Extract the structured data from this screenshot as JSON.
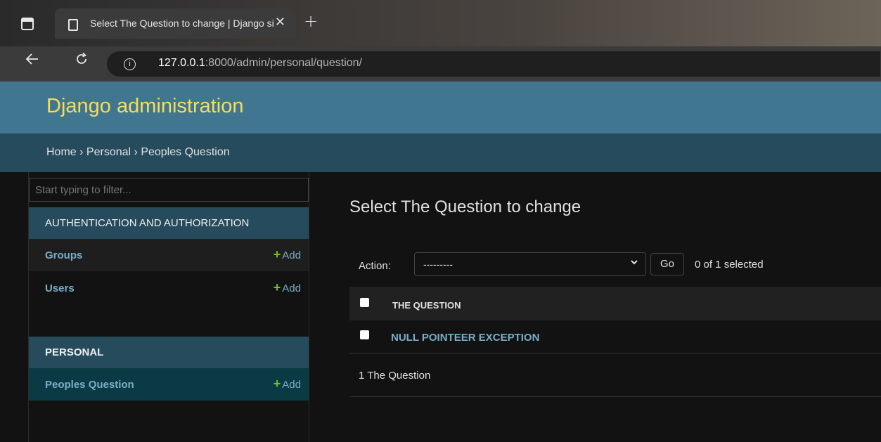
{
  "browser": {
    "tab_title": "Select The Question to change | Django site admin",
    "close_glyph": "✕",
    "new_tab_glyph": "+",
    "url_host": "127.0.0.1",
    "url_path": ":8000/admin/personal/question/"
  },
  "header": {
    "brand": "Django administration"
  },
  "breadcrumbs": {
    "home": "Home",
    "sep": "›",
    "app": "Personal",
    "current": "Peoples Question"
  },
  "sidebar": {
    "filter_placeholder": "Start typing to filter...",
    "modules": [
      {
        "caption": "AUTHENTICATION AND AUTHORIZATION",
        "items": [
          {
            "label": "Groups",
            "add": "Add"
          },
          {
            "label": "Users",
            "add": "Add"
          }
        ]
      },
      {
        "caption": "PERSONAL",
        "items": [
          {
            "label": "Peoples Question",
            "add": "Add"
          }
        ]
      }
    ]
  },
  "main": {
    "title": "Select The Question to change",
    "action_label": "Action:",
    "action_value": "---------",
    "go_label": "Go",
    "selected_text": "0 of 1 selected",
    "column_header": "THE QUESTION",
    "rows": [
      {
        "label": "NULL POINTEER EXCEPTION"
      }
    ],
    "paginator": "1 The Question"
  },
  "colors": {
    "header_bg": "#417690",
    "breadcrumb_bg": "#264b5d",
    "brand": "#f5dd5d",
    "link": "#79aec8",
    "add_plus": "#70bf2b",
    "selected_row_bg": "#0b3a44"
  }
}
